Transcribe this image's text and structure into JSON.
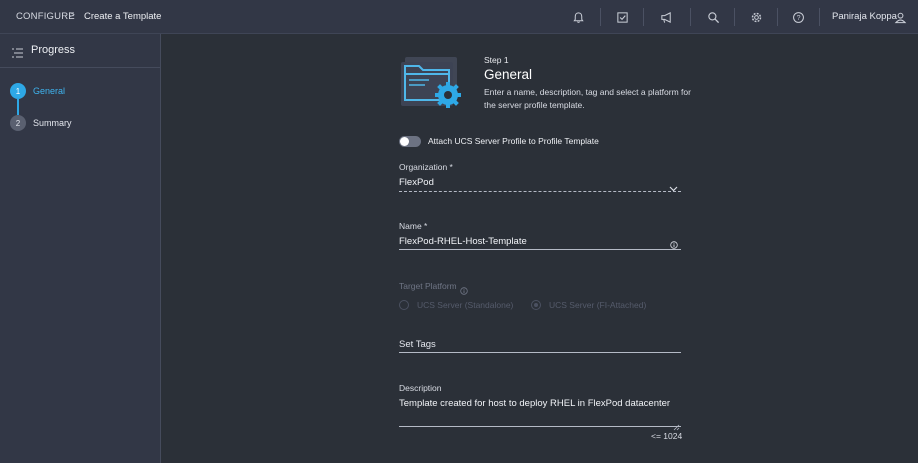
{
  "breadcrumb": {
    "root": "CONFIGURE",
    "separator": ">",
    "current": "Create a Template"
  },
  "topbar": {
    "icons": [
      "bell-icon",
      "tasks-icon",
      "announcement-icon",
      "search-icon",
      "gear-icon",
      "help-icon",
      "user-icon"
    ],
    "user_name": "Paniraja Koppa"
  },
  "sidebar": {
    "title": "Progress",
    "steps": [
      {
        "number": "1",
        "label": "General",
        "state": "active"
      },
      {
        "number": "2",
        "label": "Summary",
        "state": "pending"
      }
    ]
  },
  "main": {
    "step_number": "Step 1",
    "step_title": "General",
    "step_description": "Enter a name, description, tag and select a platform for the server profile template.",
    "attach_toggle": {
      "label": "Attach UCS Server Profile to Profile Template",
      "on": false
    },
    "organization": {
      "label": "Organization *",
      "value": "FlexPod"
    },
    "name": {
      "label": "Name *",
      "value": "FlexPod-RHEL-Host-Template"
    },
    "target_platform": {
      "label": "Target Platform",
      "options": [
        "UCS Server (Standalone)",
        "UCS Server (FI-Attached)"
      ],
      "selected": "UCS Server (FI-Attached)",
      "disabled": true
    },
    "tags": {
      "placeholder": "Set Tags"
    },
    "description": {
      "label": "Description",
      "value": "Template created for host to deploy RHEL in FlexPod datacenter",
      "limit": "<= 1024"
    }
  },
  "colors": {
    "accent": "#2ea8e6",
    "background": "#2b3038",
    "panel": "#323746"
  }
}
